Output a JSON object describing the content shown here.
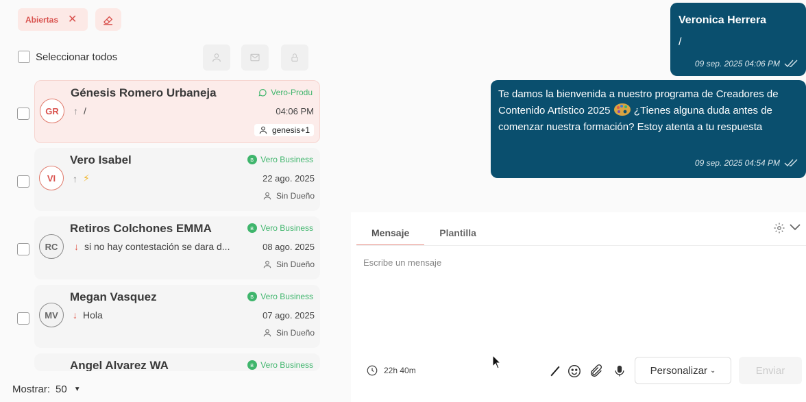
{
  "filters": {
    "open_label": "Abiertas"
  },
  "list": {
    "select_all_label": "Seleccionar todos",
    "conversations": [
      {
        "initials": "GR",
        "name": "Génesis Romero Urbaneja",
        "direction": "up",
        "preview": "/",
        "channel": "Vero-Produ",
        "date": "04:06 PM",
        "owner": "genesis+1"
      },
      {
        "initials": "VI",
        "name": "Vero Isabel",
        "direction": "up",
        "preview": "⚡",
        "channel": "Vero Business",
        "date": "22 ago. 2025",
        "owner": "Sin Dueño"
      },
      {
        "initials": "RC",
        "name": "Retiros Colchones EMMA",
        "direction": "down",
        "preview": "si no hay contestación se dara d...",
        "channel": "Vero Business",
        "date": "08 ago. 2025",
        "owner": "Sin Dueño"
      },
      {
        "initials": "MV",
        "name": "Megan Vasquez",
        "direction": "down",
        "preview": "Hola",
        "channel": "Vero Business",
        "date": "07 ago. 2025",
        "owner": "Sin Dueño"
      },
      {
        "initials": "",
        "name": "Angel Alvarez WA",
        "direction": "",
        "preview": "",
        "channel": "Vero Business",
        "date": "",
        "owner": ""
      }
    ],
    "show_label": "Mostrar:",
    "page_size": "50"
  },
  "chat": {
    "messages": [
      {
        "sender": "Veronica Herrera",
        "text": "/",
        "time": "09 sep. 2025 04:06 PM"
      },
      {
        "text_a": "Te damos la bienvenida a nuestro programa de Creadores de Contenido Artístico 2025",
        "text_b": "¿Tienes alguna duda antes de comenzar nuestra formación? Estoy atenta a tu respuesta",
        "time": "09 sep. 2025 04:54 PM"
      }
    ]
  },
  "composer": {
    "tab_message": "Mensaje",
    "tab_template": "Plantilla",
    "placeholder": "Escribe un mensaje",
    "timer": "22h 40m",
    "personalize_label": "Personalizar",
    "send_label": "Enviar"
  },
  "colors": {
    "accent": "#d9534f",
    "bubble": "#0a4f6e",
    "whatsapp": "#3fb56c"
  }
}
